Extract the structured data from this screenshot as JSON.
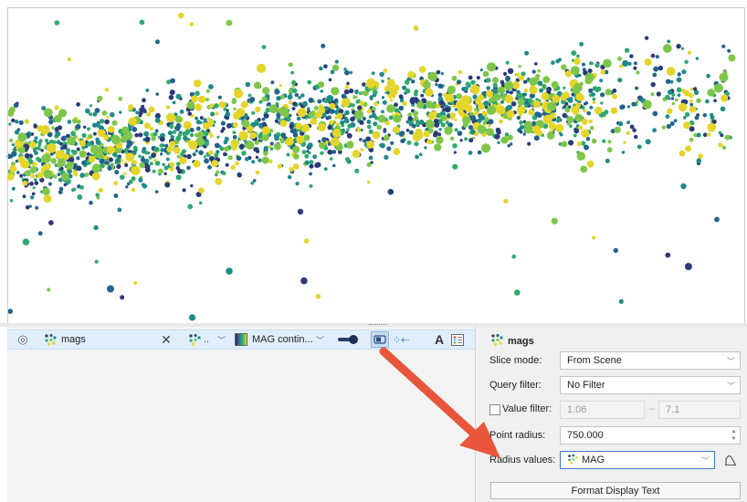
{
  "colors": {
    "accent": "#3a7bd5",
    "arrow": "#e8553a",
    "point_palette": [
      "#2b3a78",
      "#22628c",
      "#1f8a8a",
      "#2fa96e",
      "#7ec64a",
      "#e4d52a"
    ]
  },
  "viewport": {
    "content": "3D scene showing point cloud of colored spheres (mags)"
  },
  "objects_list": {
    "row": {
      "visibility_icon": "eye-icon",
      "object_icon": "points-icon",
      "name": "mags",
      "remove_icon": "close-icon",
      "attribute_icon": "points-icon",
      "attribute_label": "..",
      "colormap_name": "MAG contin...",
      "toggle_icon": "toggle-icon",
      "slice_icon": "slice-icon",
      "filter_icon": "filter-icon",
      "text_icon": "A",
      "legend_icon": "legend-icon"
    }
  },
  "properties": {
    "title": "mags",
    "title_icon": "points-icon",
    "slice_mode": {
      "label": "Slice mode:",
      "value": "From Scene"
    },
    "query_filter": {
      "label": "Query filter:",
      "value": "No Filter"
    },
    "value_filter": {
      "label": "Value filter:",
      "checked": false,
      "min": "1.06",
      "sep": "–",
      "max": "7.1"
    },
    "point_radius": {
      "label": "Point radius:",
      "value": "750.000"
    },
    "radius_values": {
      "label": "Radius values:",
      "value": "MAG"
    },
    "format_button": "Format Display Text"
  }
}
